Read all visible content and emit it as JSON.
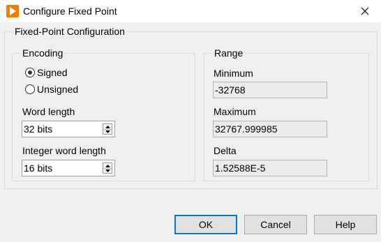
{
  "window": {
    "title": "Configure Fixed Point"
  },
  "icons": {
    "app": "labview-run-arrow-icon",
    "close": "close-icon",
    "spin_up": "arrow-up-icon",
    "spin_down": "arrow-down-icon"
  },
  "colors": {
    "app_icon": "#ef7d00",
    "default_button_border": "#0078d7"
  },
  "config_group": {
    "legend": "Fixed-Point Configuration"
  },
  "encoding": {
    "legend": "Encoding",
    "signed_label": "Signed",
    "unsigned_label": "Unsigned",
    "selected": "Signed",
    "word_length_label": "Word length",
    "word_length_value": "32 bits",
    "integer_word_length_label": "Integer word length",
    "integer_word_length_value": "16 bits"
  },
  "range": {
    "legend": "Range",
    "minimum_label": "Minimum",
    "minimum_value": "-32768",
    "maximum_label": "Maximum",
    "maximum_value": "32767.999985",
    "delta_label": "Delta",
    "delta_value": "1.52588E-5"
  },
  "buttons": {
    "ok": "OK",
    "cancel": "Cancel",
    "help": "Help"
  }
}
